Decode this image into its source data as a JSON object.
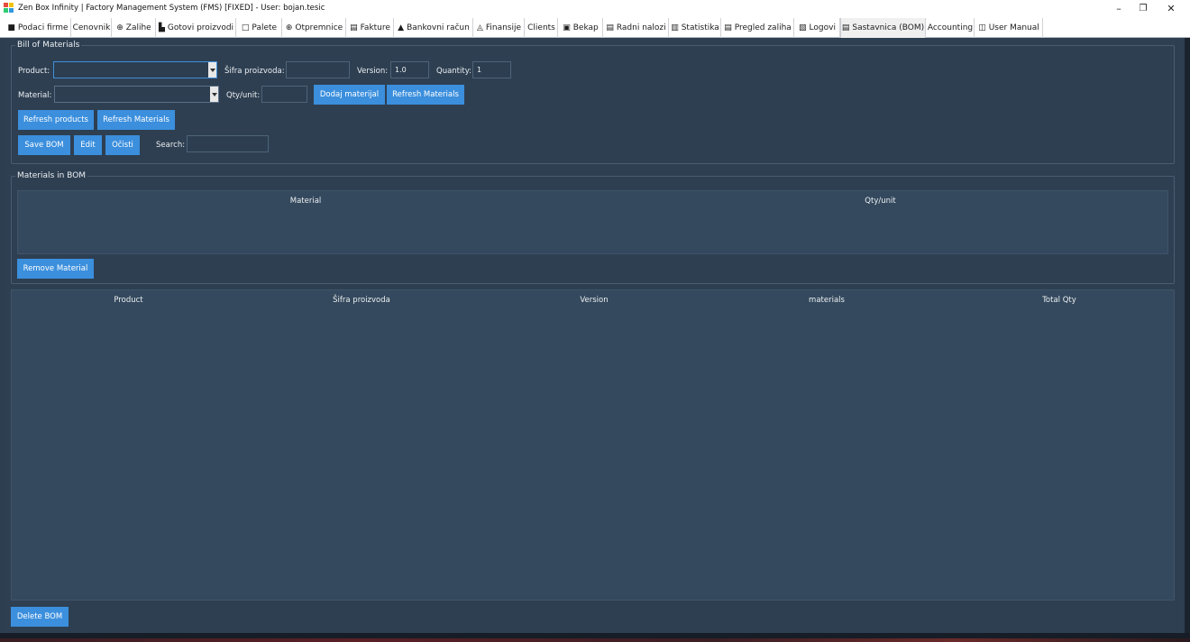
{
  "window": {
    "title": "Zen Box Infinity | Factory Management System (FMS) [FIXED] - User: bojan.tesic",
    "minimize": "–",
    "maximize": "❐",
    "close": "✕"
  },
  "tabs": [
    {
      "icon": "■",
      "label": "Podaci firme"
    },
    {
      "icon": "",
      "label": "Cenovnik"
    },
    {
      "icon": "⊕",
      "label": "Zalihe"
    },
    {
      "icon": "▙",
      "label": "Gotovi proizvodi"
    },
    {
      "icon": "□",
      "label": "Palete"
    },
    {
      "icon": "⊕",
      "label": "Otpremnice"
    },
    {
      "icon": "▤",
      "label": "Fakture"
    },
    {
      "icon": "▲",
      "label": "Bankovni račun"
    },
    {
      "icon": "◬",
      "label": "Finansije"
    },
    {
      "icon": "",
      "label": "Clients"
    },
    {
      "icon": "▣",
      "label": "Bekap"
    },
    {
      "icon": "▤",
      "label": "Radni nalozi"
    },
    {
      "icon": "▥",
      "label": "Statistika"
    },
    {
      "icon": "▤",
      "label": "Pregled zaliha"
    },
    {
      "icon": "▧",
      "label": "Logovi"
    },
    {
      "icon": "▤",
      "label": "Sastavnica (BOM)"
    },
    {
      "icon": "",
      "label": "Accounting"
    },
    {
      "icon": "◫",
      "label": "User Manual"
    }
  ],
  "bom_form": {
    "group_title": "Bill of Materials",
    "product_label": "Product:",
    "product_value": "",
    "sifra_label": "Šifra proizvoda:",
    "sifra_value": "",
    "version_label": "Version:",
    "version_value": "1.0",
    "quantity_label": "Quantity:",
    "quantity_value": "1",
    "material_label": "Material:",
    "material_value": "",
    "qty_unit_label": "Qty/unit:",
    "qty_unit_value": "",
    "add_material_button": "Dodaj materijal",
    "refresh_materials_button_1": "Refresh Materials",
    "refresh_products_button": "Refresh products",
    "refresh_materials_button_2": "Refresh Materials",
    "save_button": "Save BOM",
    "edit_button": "Edit",
    "clear_button": "Očisti",
    "search_label": "Search:",
    "search_value": ""
  },
  "materials_group": {
    "group_title": "Materials in BOM",
    "columns": [
      "Material",
      "Qty/unit"
    ],
    "remove_button": "Remove Material"
  },
  "bom_list": {
    "columns": [
      "Product",
      "Šifra proizvoda",
      "Version",
      "materials",
      "Total Qty"
    ],
    "delete_button": "Delete BOM"
  },
  "colors": {
    "background": "#2e3f52",
    "accent": "#3b8fdd",
    "table": "#34495e"
  }
}
